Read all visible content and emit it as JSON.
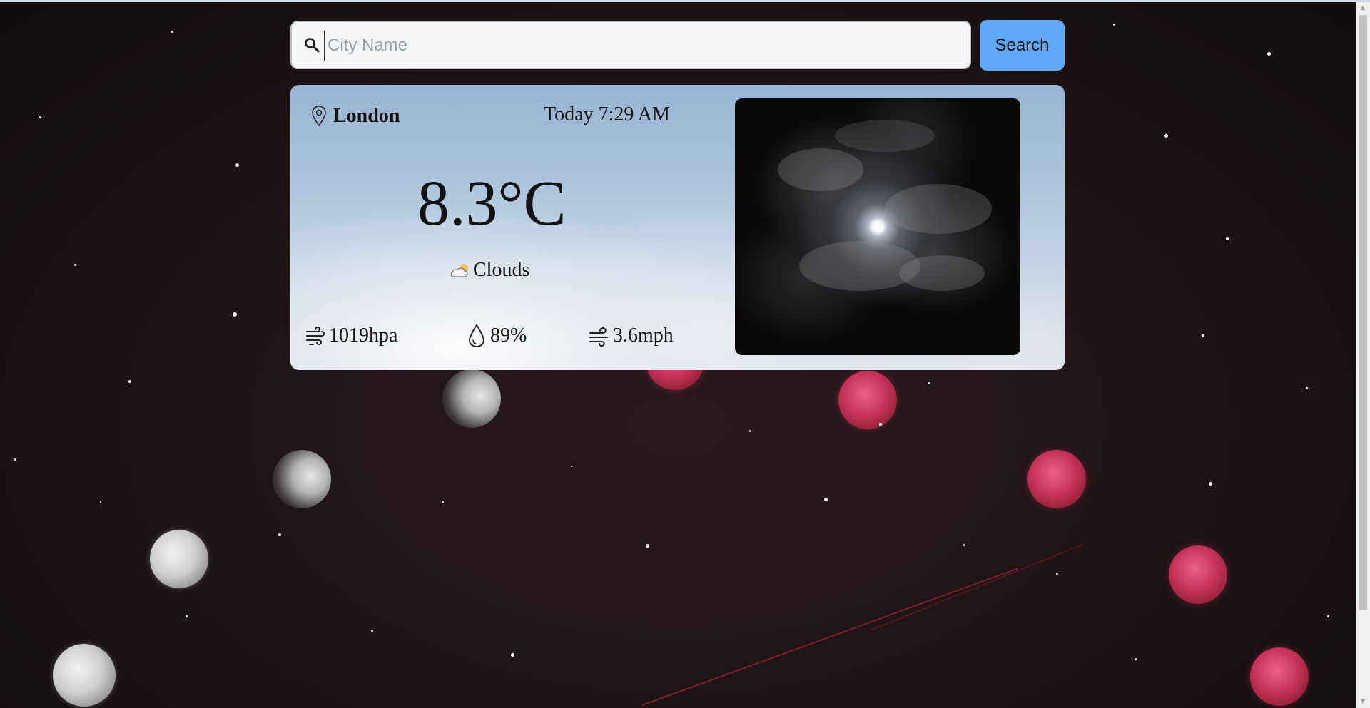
{
  "search": {
    "placeholder": "City Name",
    "value": "",
    "button_label": "Search",
    "button_color": "#5fa8f6"
  },
  "weather": {
    "city": "London",
    "date_time": "Today 7:29 AM",
    "temperature": "8.3°C",
    "condition": "Clouds",
    "condition_icon": "cloud-icon",
    "stats": {
      "pressure": "1019hpa",
      "humidity": "89%",
      "wind": "3.6mph"
    }
  },
  "icons": [
    "search-icon",
    "map-pin-icon",
    "cloud-icon",
    "pressure-icon",
    "droplet-icon",
    "wind-icon"
  ]
}
